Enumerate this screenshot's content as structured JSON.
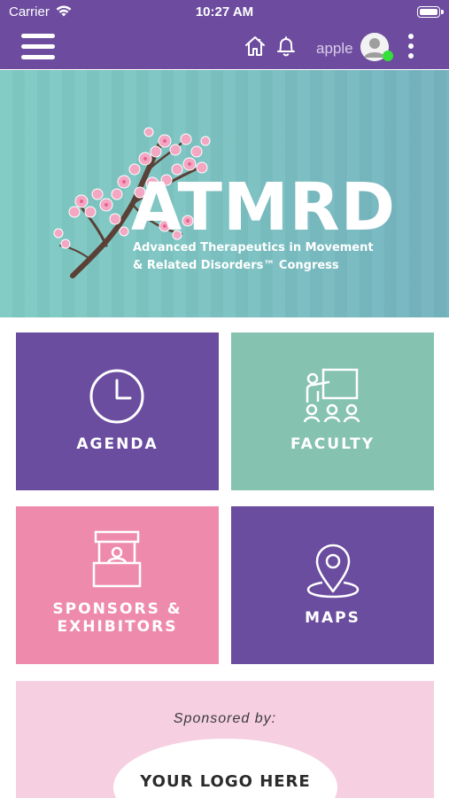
{
  "status_bar": {
    "carrier": "Carrier",
    "time": "10:27 AM",
    "wifi_icon": "wifi-icon",
    "battery_icon": "battery-icon"
  },
  "nav": {
    "menu_icon": "hamburger-menu-icon",
    "home_icon": "home-icon",
    "bell_icon": "bell-icon",
    "username": "apple",
    "avatar_icon": "user-avatar-icon",
    "online_status": "online",
    "more_icon": "more-vertical-icon"
  },
  "banner": {
    "title": "ATMRD",
    "subtitle_line1": "Advanced Therapeutics in Movement",
    "subtitle_line2": "& Related Disorders™ Congress"
  },
  "tiles": [
    {
      "label": "AGENDA",
      "icon": "clock-icon",
      "color": "#6b4da0"
    },
    {
      "label": "FACULTY",
      "icon": "presentation-icon",
      "color": "#86c2b0"
    },
    {
      "label_line1": "SPONSORS &",
      "label_line2": "EXHIBITORS",
      "icon": "booth-icon",
      "color": "#ee8bad"
    },
    {
      "label": "MAPS",
      "icon": "map-pin-icon",
      "color": "#6b4da0"
    }
  ],
  "sponsor": {
    "text": "Sponsored by:",
    "logo_text": "YOUR LOGO HERE",
    "color": "#f6cfe0"
  },
  "colors": {
    "nav_purple": "#6d4c9f",
    "banner_teal": "#7cc3c2",
    "online_green": "#35e03a"
  }
}
